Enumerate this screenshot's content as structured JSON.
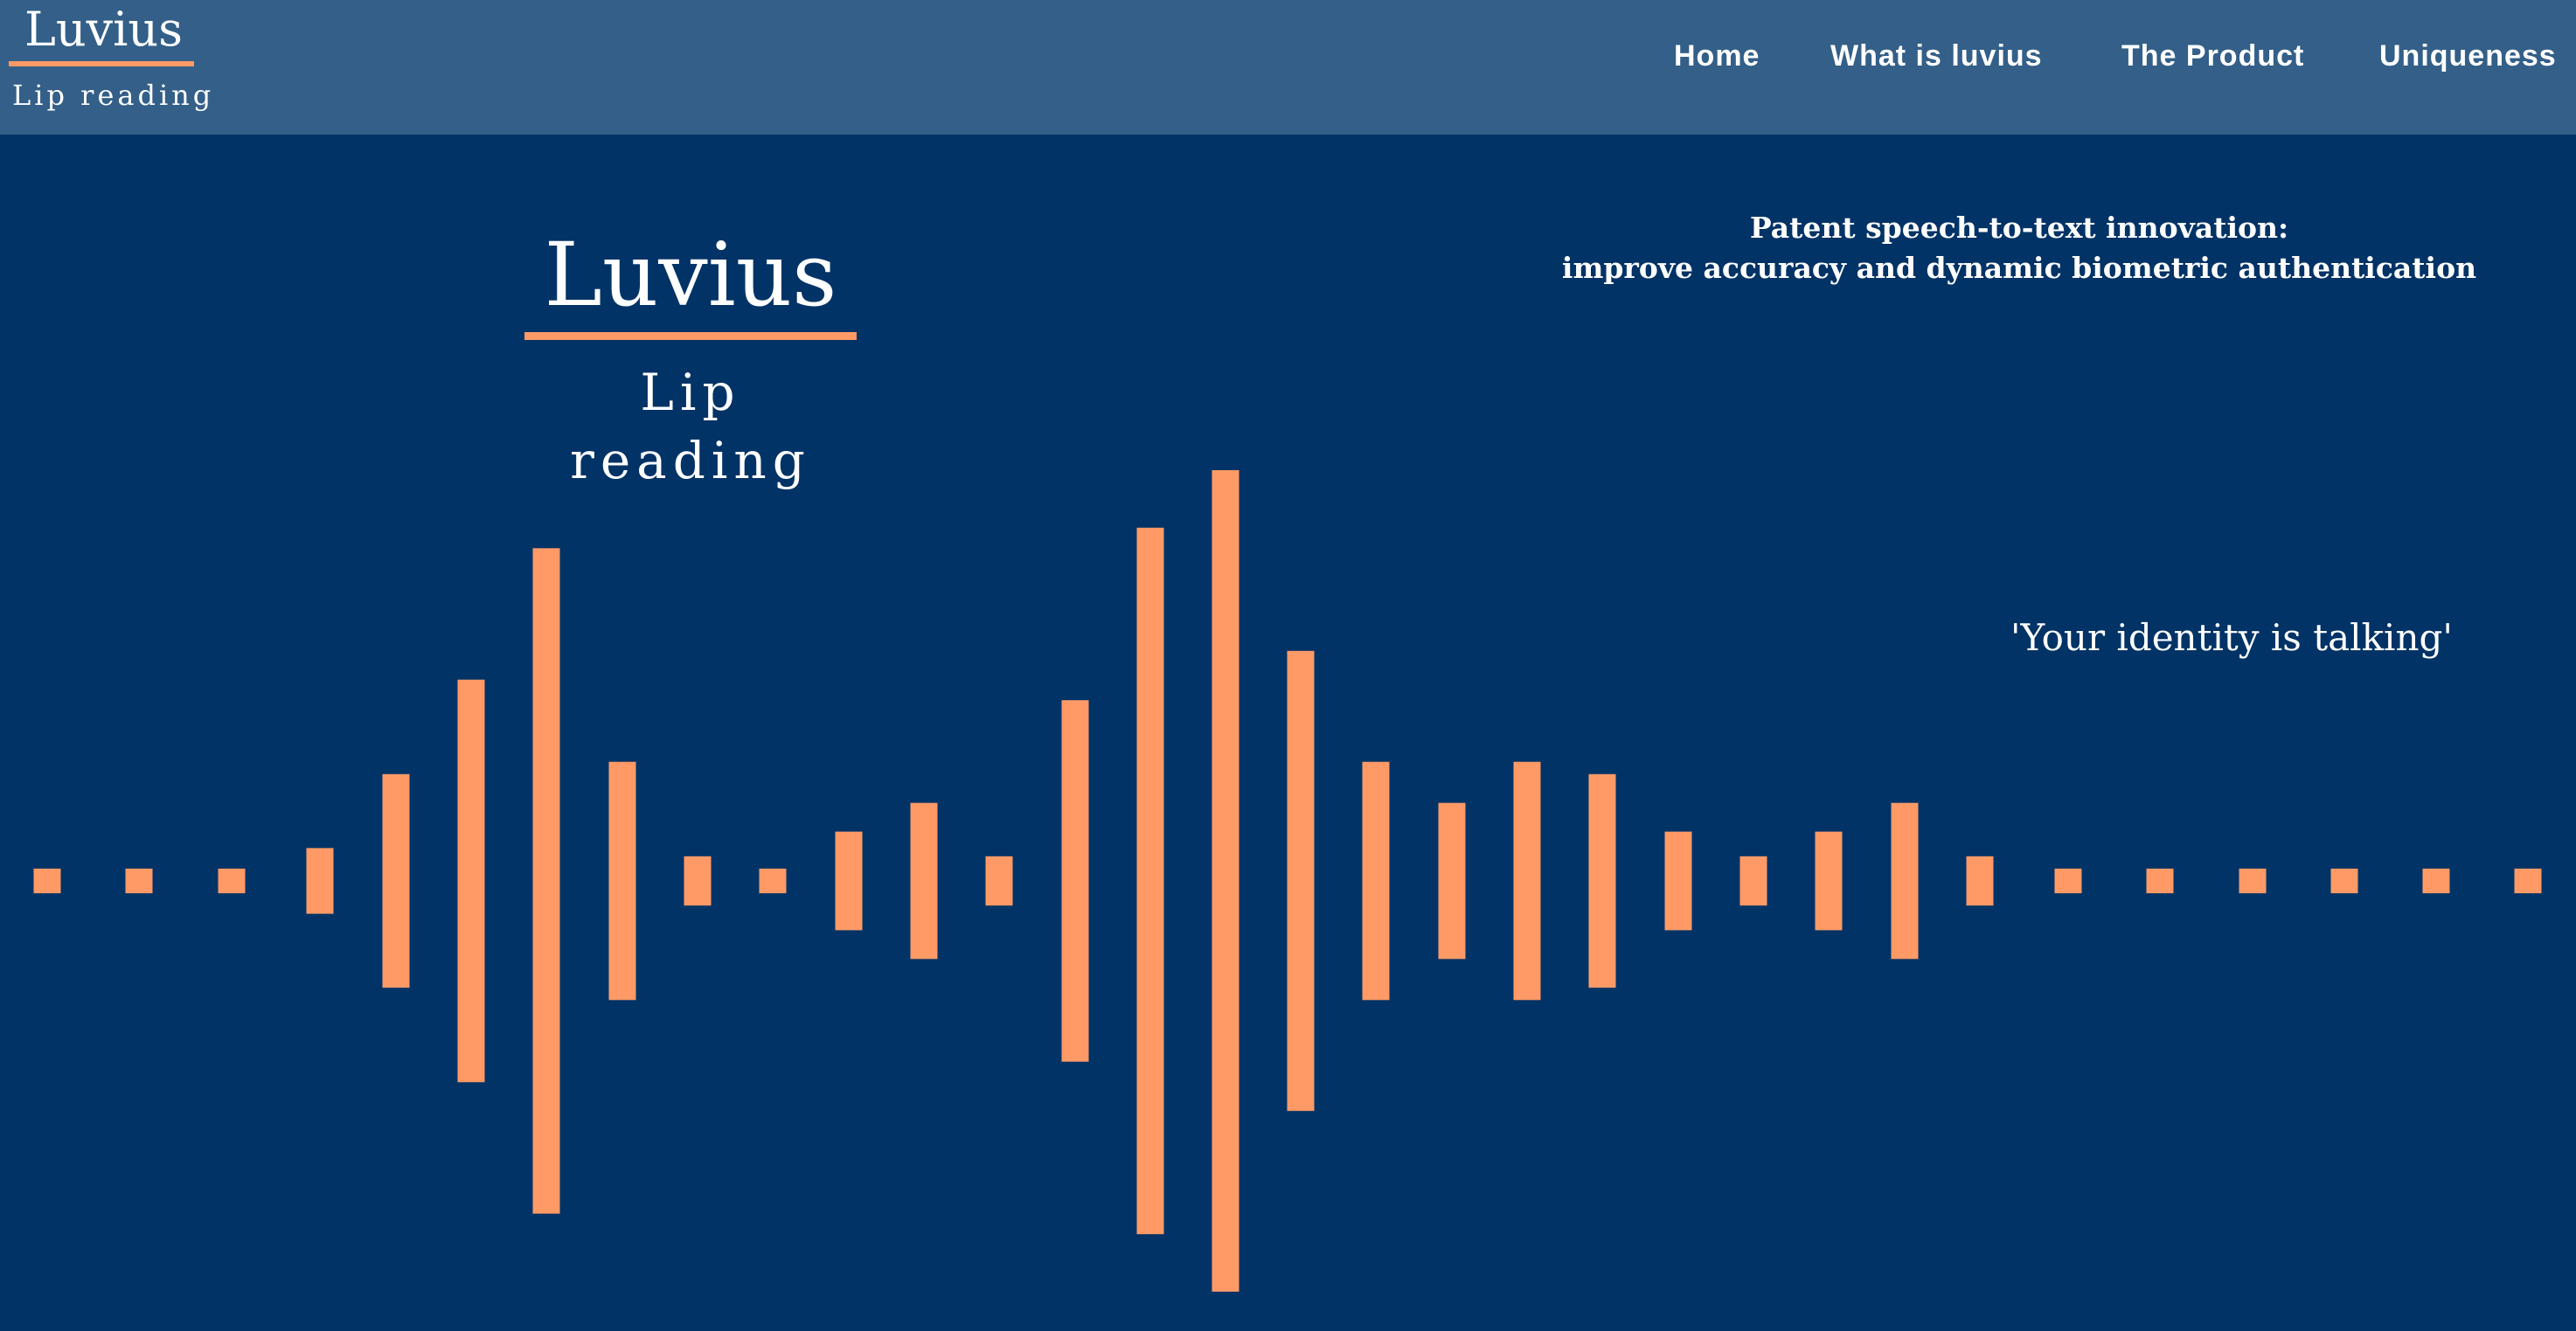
{
  "header": {
    "logo_title": "Luvius",
    "logo_subtitle": "Lip reading",
    "nav": [
      {
        "label": "Home"
      },
      {
        "label": "What is luvius"
      },
      {
        "label": "The Product"
      },
      {
        "label": "Uniqueness"
      }
    ]
  },
  "hero": {
    "title": "Luvius",
    "subtitle": "Lip reading",
    "tagline_line1": "Patent speech-to-text innovation:",
    "tagline_line2": "improve accuracy and dynamic biometric authentication",
    "quote": "'Your identity is talking'"
  },
  "colors": {
    "background": "#013366",
    "topbar": "#335f88",
    "accent": "#ff9a66",
    "text": "#ffffff"
  },
  "waveform": {
    "bar_levels": [
      0.03,
      0.03,
      0.03,
      0.08,
      0.26,
      0.49,
      0.81,
      0.29,
      0.06,
      0.03,
      0.12,
      0.19,
      0.06,
      0.44,
      0.86,
      1.0,
      0.56,
      0.29,
      0.19,
      0.29,
      0.26,
      0.12,
      0.06,
      0.12,
      0.19,
      0.06,
      0.03,
      0.03,
      0.03,
      0.03,
      0.03,
      0.03
    ]
  }
}
